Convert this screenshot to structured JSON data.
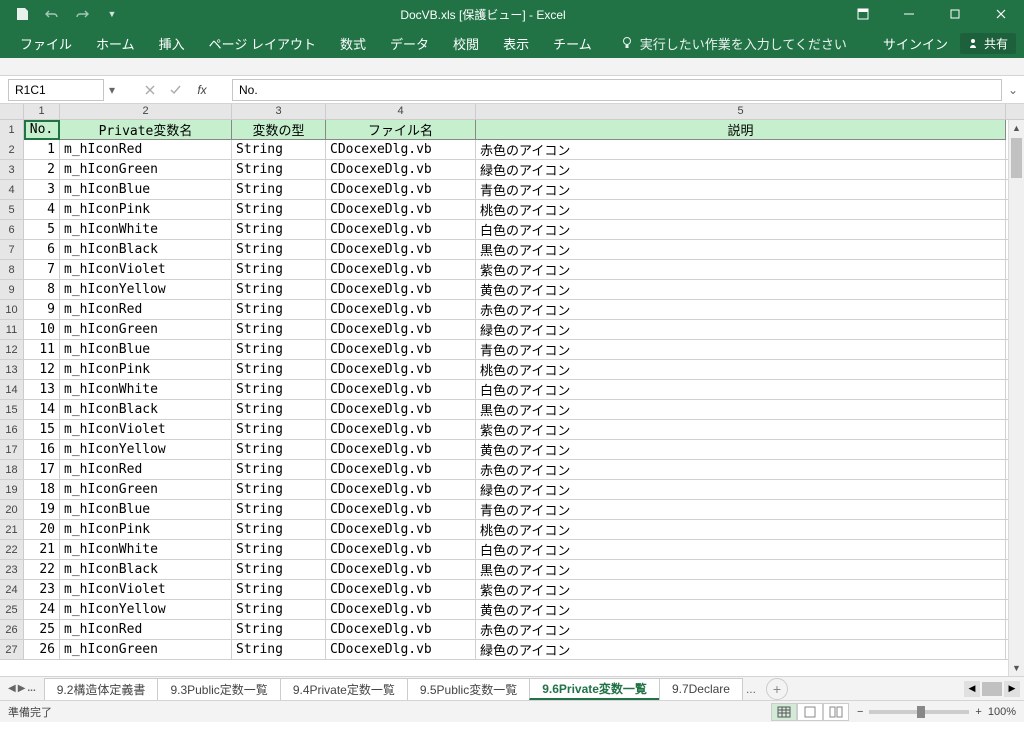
{
  "title": "DocVB.xls [保護ビュー] - Excel",
  "qat": {
    "save": "save",
    "undo": "undo",
    "redo": "redo",
    "customize": "▾"
  },
  "ribbon": {
    "tabs": [
      "ファイル",
      "ホーム",
      "挿入",
      "ページ レイアウト",
      "数式",
      "データ",
      "校閲",
      "表示",
      "チーム"
    ],
    "tell_me": "実行したい作業を入力してください",
    "signin": "サインイン",
    "share": "共有"
  },
  "formula": {
    "name_box": "R1C1",
    "fx_label": "fx",
    "value": "No."
  },
  "col_numbers": [
    "1",
    "2",
    "3",
    "4",
    "5"
  ],
  "headers": {
    "no": "No.",
    "var": "Private変数名",
    "type": "変数の型",
    "file": "ファイル名",
    "desc": "説明"
  },
  "rows": [
    {
      "n": "1",
      "v": "m_hIconRed",
      "t": "String",
      "f": "CDocexeDlg.vb",
      "d": "赤色のアイコン"
    },
    {
      "n": "2",
      "v": "m_hIconGreen",
      "t": "String",
      "f": "CDocexeDlg.vb",
      "d": "緑色のアイコン"
    },
    {
      "n": "3",
      "v": "m_hIconBlue",
      "t": "String",
      "f": "CDocexeDlg.vb",
      "d": "青色のアイコン"
    },
    {
      "n": "4",
      "v": "m_hIconPink",
      "t": "String",
      "f": "CDocexeDlg.vb",
      "d": "桃色のアイコン"
    },
    {
      "n": "5",
      "v": "m_hIconWhite",
      "t": "String",
      "f": "CDocexeDlg.vb",
      "d": "白色のアイコン"
    },
    {
      "n": "6",
      "v": "m_hIconBlack",
      "t": "String",
      "f": "CDocexeDlg.vb",
      "d": "黒色のアイコン"
    },
    {
      "n": "7",
      "v": "m_hIconViolet",
      "t": "String",
      "f": "CDocexeDlg.vb",
      "d": "紫色のアイコン"
    },
    {
      "n": "8",
      "v": "m_hIconYellow",
      "t": "String",
      "f": "CDocexeDlg.vb",
      "d": "黄色のアイコン"
    },
    {
      "n": "9",
      "v": "m_hIconRed",
      "t": "String",
      "f": "CDocexeDlg.vb",
      "d": "赤色のアイコン"
    },
    {
      "n": "10",
      "v": "m_hIconGreen",
      "t": "String",
      "f": "CDocexeDlg.vb",
      "d": "緑色のアイコン"
    },
    {
      "n": "11",
      "v": "m_hIconBlue",
      "t": "String",
      "f": "CDocexeDlg.vb",
      "d": "青色のアイコン"
    },
    {
      "n": "12",
      "v": "m_hIconPink",
      "t": "String",
      "f": "CDocexeDlg.vb",
      "d": "桃色のアイコン"
    },
    {
      "n": "13",
      "v": "m_hIconWhite",
      "t": "String",
      "f": "CDocexeDlg.vb",
      "d": "白色のアイコン"
    },
    {
      "n": "14",
      "v": "m_hIconBlack",
      "t": "String",
      "f": "CDocexeDlg.vb",
      "d": "黒色のアイコン"
    },
    {
      "n": "15",
      "v": "m_hIconViolet",
      "t": "String",
      "f": "CDocexeDlg.vb",
      "d": "紫色のアイコン"
    },
    {
      "n": "16",
      "v": "m_hIconYellow",
      "t": "String",
      "f": "CDocexeDlg.vb",
      "d": "黄色のアイコン"
    },
    {
      "n": "17",
      "v": "m_hIconRed",
      "t": "String",
      "f": "CDocexeDlg.vb",
      "d": "赤色のアイコン"
    },
    {
      "n": "18",
      "v": "m_hIconGreen",
      "t": "String",
      "f": "CDocexeDlg.vb",
      "d": "緑色のアイコン"
    },
    {
      "n": "19",
      "v": "m_hIconBlue",
      "t": "String",
      "f": "CDocexeDlg.vb",
      "d": "青色のアイコン"
    },
    {
      "n": "20",
      "v": "m_hIconPink",
      "t": "String",
      "f": "CDocexeDlg.vb",
      "d": "桃色のアイコン"
    },
    {
      "n": "21",
      "v": "m_hIconWhite",
      "t": "String",
      "f": "CDocexeDlg.vb",
      "d": "白色のアイコン"
    },
    {
      "n": "22",
      "v": "m_hIconBlack",
      "t": "String",
      "f": "CDocexeDlg.vb",
      "d": "黒色のアイコン"
    },
    {
      "n": "23",
      "v": "m_hIconViolet",
      "t": "String",
      "f": "CDocexeDlg.vb",
      "d": "紫色のアイコン"
    },
    {
      "n": "24",
      "v": "m_hIconYellow",
      "t": "String",
      "f": "CDocexeDlg.vb",
      "d": "黄色のアイコン"
    },
    {
      "n": "25",
      "v": "m_hIconRed",
      "t": "String",
      "f": "CDocexeDlg.vb",
      "d": "赤色のアイコン"
    },
    {
      "n": "26",
      "v": "m_hIconGreen",
      "t": "String",
      "f": "CDocexeDlg.vb",
      "d": "緑色のアイコン"
    }
  ],
  "sheets": {
    "ellipsis": "...",
    "tabs": [
      "9.2構造体定義書",
      "9.3Public定数一覧",
      "9.4Private定数一覧",
      "9.5Public変数一覧",
      "9.6Private変数一覧",
      "9.7Declare"
    ],
    "active_index": 4,
    "trailing_ellipsis": "..."
  },
  "status": {
    "ready": "準備完了",
    "zoom_pct": "100%",
    "minus": "−",
    "plus": "+"
  }
}
